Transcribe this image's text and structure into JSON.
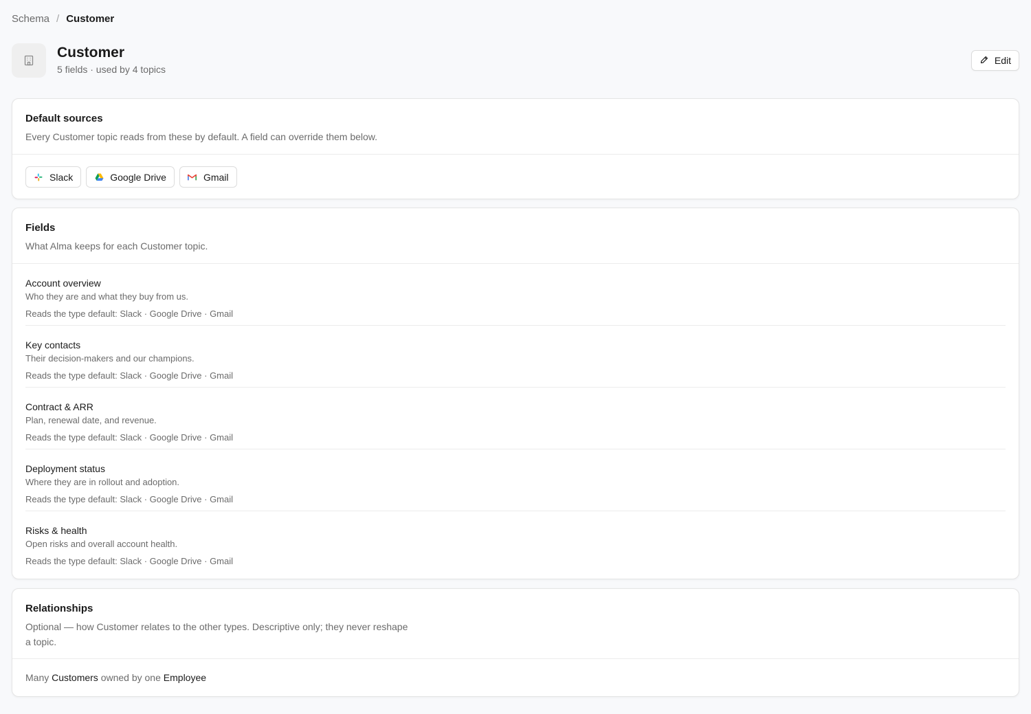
{
  "breadcrumb": {
    "parent": "Schema",
    "separator": "/",
    "current": "Customer"
  },
  "header": {
    "icon": "building-icon",
    "title": "Customer",
    "subtitle": "5 fields · used by 4 topics",
    "edit_label": "Edit"
  },
  "sources": {
    "title": "Default sources",
    "description": "Every Customer topic reads from these by default. A field can override them below.",
    "chips": [
      {
        "label": "Slack",
        "icon": "slack-icon"
      },
      {
        "label": "Google Drive",
        "icon": "google-drive-icon"
      },
      {
        "label": "Gmail",
        "icon": "gmail-icon"
      }
    ]
  },
  "fields": {
    "title": "Fields",
    "description": "What Alma keeps for each Customer topic.",
    "items": [
      {
        "name": "Account overview",
        "description": "Who they are and what they buy from us.",
        "sources": "Reads the type default: Slack · Google Drive · Gmail"
      },
      {
        "name": "Key contacts",
        "description": "Their decision-makers and our champions.",
        "sources": "Reads the type default: Slack · Google Drive · Gmail"
      },
      {
        "name": "Contract & ARR",
        "description": "Plan, renewal date, and revenue.",
        "sources": "Reads the type default: Slack · Google Drive · Gmail"
      },
      {
        "name": "Deployment status",
        "description": "Where they are in rollout and adoption.",
        "sources": "Reads the type default: Slack · Google Drive · Gmail"
      },
      {
        "name": "Risks & health",
        "description": "Open risks and overall account health.",
        "sources": "Reads the type default: Slack · Google Drive · Gmail"
      }
    ]
  },
  "relationships": {
    "title": "Relationships",
    "description": "Optional — how Customer relates to the other types. Descriptive only; they never reshape a topic.",
    "items": [
      {
        "prefix": "Many",
        "subject": "Customers",
        "relation": "owned by one",
        "object": "Employee"
      }
    ]
  },
  "colors": {
    "background": "#f8f9fb",
    "card": "#ffffff",
    "border": "#e5e5e5",
    "text_primary": "#1a1a1a",
    "text_secondary": "#6b6b6b"
  }
}
